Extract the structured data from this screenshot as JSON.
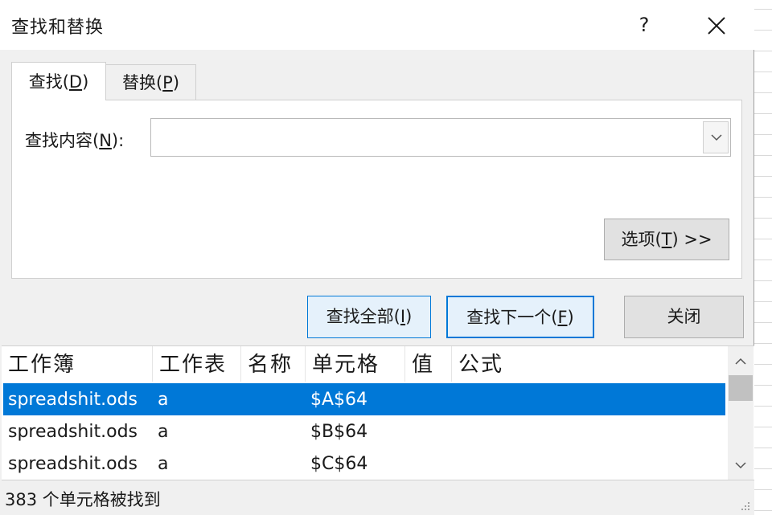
{
  "window": {
    "title": "查找和替换",
    "help_label": "?"
  },
  "tabs": [
    {
      "label_main": "查找(",
      "label_key": "D",
      "label_end": ")",
      "active": true
    },
    {
      "label_main": "替换(",
      "label_key": "P",
      "label_end": ")",
      "active": false
    }
  ],
  "find": {
    "label_main": "查找内容(",
    "label_key": "N",
    "label_end": "):",
    "value": "",
    "placeholder": ""
  },
  "buttons": {
    "options": {
      "main": "选项(",
      "key": "T",
      "end": ") >>"
    },
    "find_all": {
      "main": "查找全部(",
      "key": "I",
      "end": ")"
    },
    "find_next": {
      "main": "查找下一个(",
      "key": "F",
      "end": ")"
    },
    "close": "关闭"
  },
  "results": {
    "columns": [
      "工作簿",
      "工作表",
      "名称",
      "单元格",
      "值",
      "公式"
    ],
    "rows": [
      {
        "workbook": "spreadshit.ods",
        "sheet": "a",
        "name": "",
        "cell": "$A$64",
        "value": "",
        "formula": "",
        "selected": true
      },
      {
        "workbook": "spreadshit.ods",
        "sheet": "a",
        "name": "",
        "cell": "$B$64",
        "value": "",
        "formula": "",
        "selected": false
      },
      {
        "workbook": "spreadshit.ods",
        "sheet": "a",
        "name": "",
        "cell": "$C$64",
        "value": "",
        "formula": "",
        "selected": false
      }
    ]
  },
  "status": {
    "text": "383 个单元格被找到"
  },
  "colors": {
    "selection": "#0078d7",
    "dialog_bg": "#f0f0f0",
    "button_focus_border": "#0078d7"
  }
}
